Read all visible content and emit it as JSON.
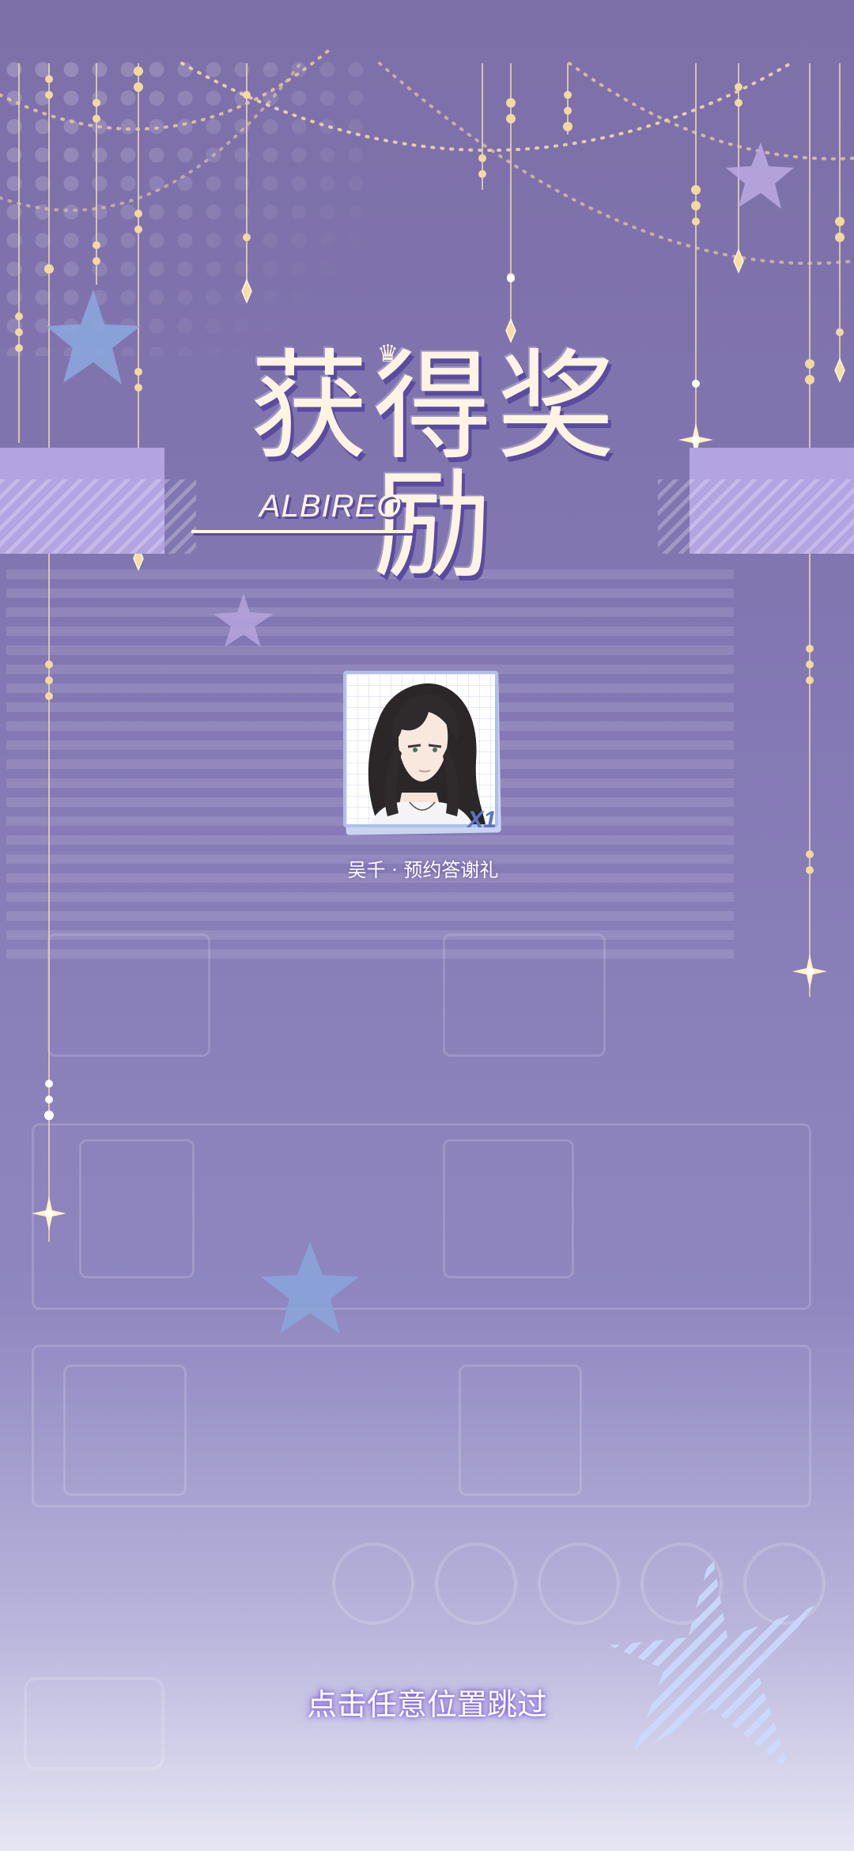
{
  "title": {
    "main": "获得奖励",
    "subtitle": "ALBIREO"
  },
  "reward": {
    "name": "吴千 · 预约答谢礼",
    "count": "X1",
    "icon": "character-portrait"
  },
  "hint": {
    "skip": "点击任意位置跳过"
  },
  "colors": {
    "background_top": "#7d6fa8",
    "background_bottom": "#e7e6f4",
    "ribbon": "#b3a3e0",
    "title_text": "#fff4e2",
    "title_shadow": "#5a4aa0",
    "star_blue": "#8aa6dc",
    "star_lavender": "#b9a6df",
    "bead_gold": "#f3d9a0"
  }
}
